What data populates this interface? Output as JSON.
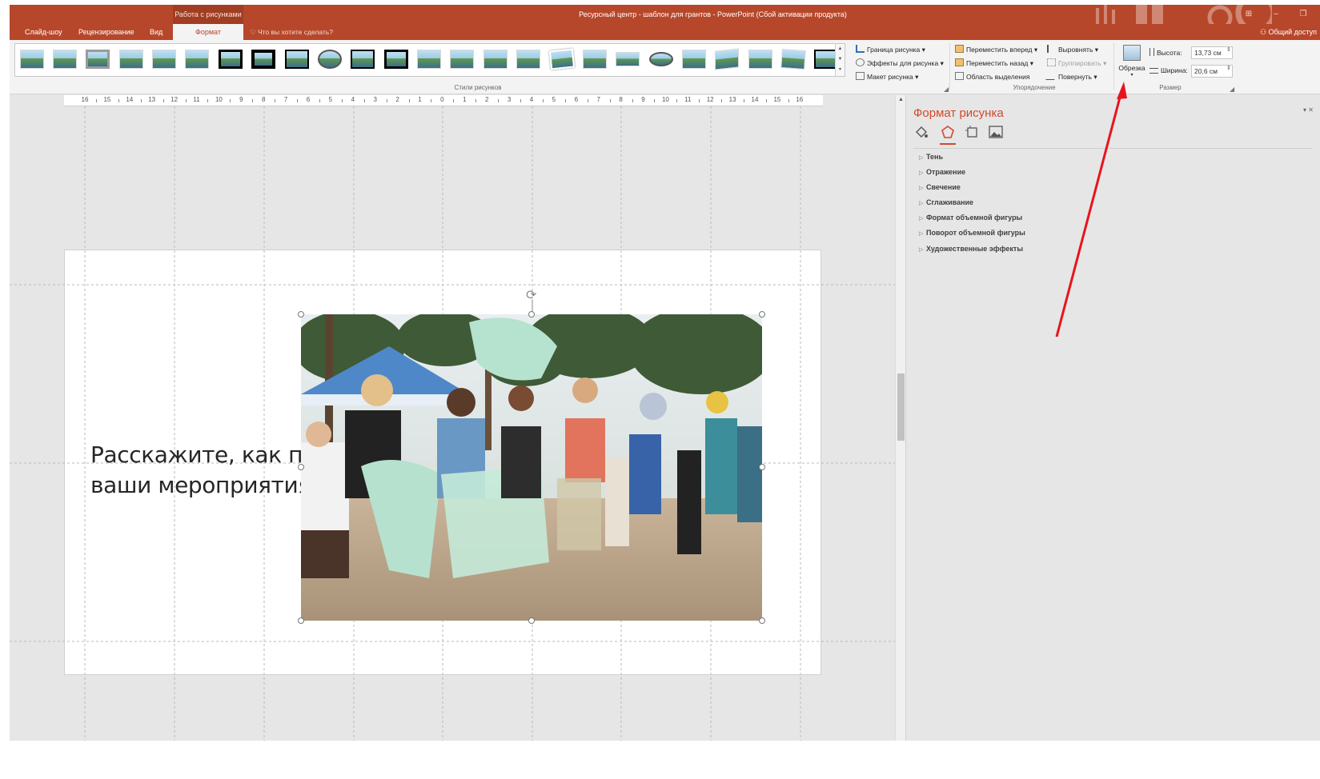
{
  "window": {
    "context_label": "Работа с рисунками",
    "title": "Ресурсный центр - шаблон для грантов - PowerPoint (Сбой активации продукта)"
  },
  "tabs": [
    {
      "label": "Слайд-шоу"
    },
    {
      "label": "Рецензирование"
    },
    {
      "label": "Вид"
    },
    {
      "label": "Формат"
    }
  ],
  "tell_me": "Что вы хотите сделать?",
  "share": "Общий доступ",
  "ribbon": {
    "styles_group": "Стили рисунков",
    "picture_border": "Граница рисунка",
    "picture_effects": "Эффекты для рисунка",
    "picture_layout": "Макет рисунка",
    "bring_forward": "Переместить вперед",
    "send_backward": "Переместить назад",
    "selection_pane": "Область выделения",
    "align": "Выровнять",
    "group": "Группировать",
    "rotate": "Повернуть",
    "arrange_group": "Упорядочение",
    "crop": "Обрезка",
    "height_label": "Высота:",
    "height_value": "13,73 см",
    "width_label": "Ширина:",
    "width_value": "20,6 см",
    "size_group": "Размер"
  },
  "ruler_labels": [
    "16",
    "15",
    "14",
    "13",
    "12",
    "11",
    "10",
    "9",
    "8",
    "7",
    "6",
    "5",
    "4",
    "3",
    "2",
    "1",
    "0",
    "1",
    "2",
    "3",
    "4",
    "5",
    "6",
    "7",
    "8",
    "9",
    "10",
    "11",
    "12",
    "13",
    "14",
    "15",
    "16"
  ],
  "slide": {
    "text_line1": "Расскажите, как про",
    "text_line2": "ваши мероприятия"
  },
  "pane": {
    "title": "Формат рисунка",
    "sections": [
      "Тень",
      "Отражение",
      "Свечение",
      "Сглаживание",
      "Формат объемной фигуры",
      "Поворот объемной фигуры",
      "Художественные эффекты"
    ]
  },
  "colors": {
    "accent": "#b7472a",
    "annotation_arrow": "#e8141c"
  }
}
